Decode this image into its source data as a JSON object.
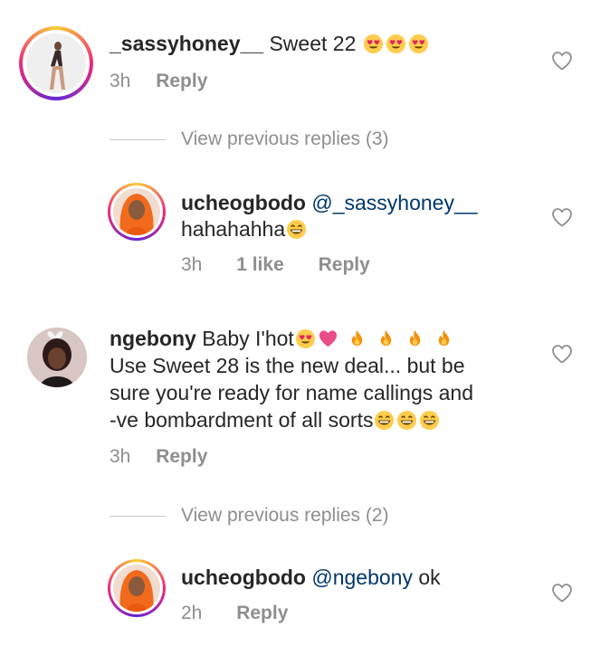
{
  "comments": [
    {
      "username": "_sassyhoney__",
      "text": "Sweet 22",
      "emojis": [
        "heart-eyes",
        "heart-eyes",
        "heart-eyes"
      ],
      "time": "3h",
      "reply_label": "Reply"
    },
    {
      "username": "ngebony",
      "line1_text": "Baby  I'hot",
      "line1_emojis": [
        "heart-eyes",
        "pink-heart",
        "fire",
        "fire",
        "fire",
        "fire"
      ],
      "line2": "Use Sweet 28 is the new deal... but be",
      "line3": "sure you're ready for name callings and",
      "line4_text": "-ve bombardment of all sorts",
      "line4_emojis": [
        "grin",
        "grin",
        "grin"
      ],
      "time": "3h",
      "reply_label": "Reply"
    }
  ],
  "replies": [
    {
      "view_previous": "View previous replies (3)",
      "username": "ucheogbodo",
      "mention": "@_sassyhoney__",
      "text": "hahahahha",
      "emojis": [
        "grin"
      ],
      "time": "3h",
      "likes": "1 like",
      "reply_label": "Reply"
    },
    {
      "view_previous": "View previous replies (2)",
      "username": "ucheogbodo",
      "mention": "@ngebony",
      "text": "ok",
      "time": "2h",
      "reply_label": "Reply"
    }
  ],
  "colors": {
    "story_ring": "#d6249f",
    "mention": "#00376b",
    "meta": "#8e8e8e"
  }
}
